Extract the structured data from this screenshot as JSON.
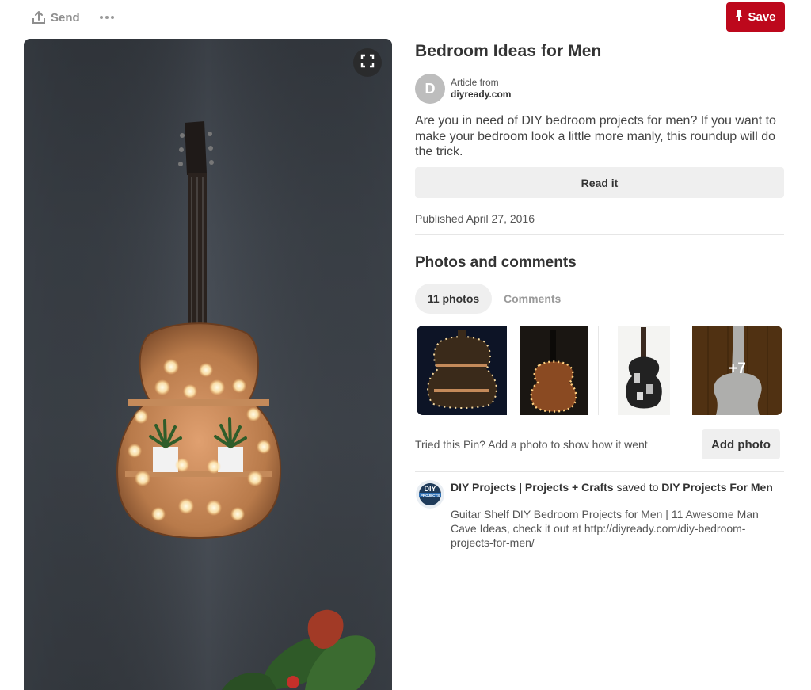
{
  "toolbar": {
    "send_label": "Send",
    "send_icon": "share-icon",
    "more_icon": "more-dots-icon",
    "save_label": "Save",
    "save_icon": "pushpin-icon",
    "save_color": "#bd081c"
  },
  "pin": {
    "expand_icon": "expand-icon",
    "title": "Bedroom Ideas for Men",
    "source_label": "Article from",
    "source_domain": "diyready.com",
    "avatar_letter": "D",
    "description": "Are you in need of DIY bedroom projects for men? If you want to make your bedroom look a little more manly, this roundup will do the trick.",
    "read_label": "Read it",
    "published": "Published April 27, 2016"
  },
  "photos": {
    "section_title": "Photos and comments",
    "tabs": [
      {
        "label": "11 photos",
        "active": true
      },
      {
        "label": "Comments",
        "active": false
      }
    ],
    "more_count": "+7",
    "tried_text": "Tried this Pin? Add a photo to show how it went",
    "add_photo_label": "Add photo"
  },
  "saved": {
    "user": "DIY Projects | Projects + Crafts",
    "action": " saved to ",
    "board": "DIY Projects For Men",
    "avatar_text": "DIY PROJECTS",
    "description": "Guitar Shelf DIY Bedroom Projects for Men | 11 Awesome Man Cave Ideas, check it out at http://diyready.com/diy-bedroom-projects-for-men/"
  }
}
